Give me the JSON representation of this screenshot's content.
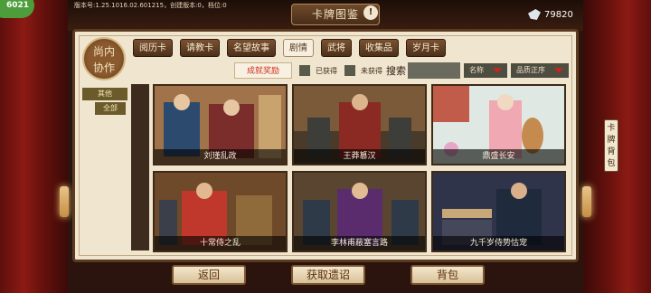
{
  "status": {
    "version_text": "版本号:1.25.1016.02.601215，创建版本:0，档位:0",
    "badge": "6021"
  },
  "header": {
    "title": "卡牌图鉴",
    "info_glyph": "!",
    "currency_value": "79820"
  },
  "emblem": {
    "text_line1": "尚内",
    "text_line2": "协作"
  },
  "tabs": [
    {
      "label": "阅历卡",
      "active": false
    },
    {
      "label": "请教卡",
      "active": false
    },
    {
      "label": "名望故事",
      "active": false
    },
    {
      "label": "剧情",
      "active": true
    },
    {
      "label": "武将",
      "active": false
    },
    {
      "label": "收集品",
      "active": false
    },
    {
      "label": "岁月卡",
      "active": false
    }
  ],
  "filters": {
    "achievement_btn": "成就奖励",
    "owned": "已获得",
    "not_owned": "未获得",
    "search_label": "搜索",
    "sort_name": "名称",
    "sort_order": "品质正序"
  },
  "side_menu": {
    "other": "其他",
    "all": "全部"
  },
  "cards": [
    {
      "title": "刘瑾乱政"
    },
    {
      "title": "王莽篡汉"
    },
    {
      "title": "鼎盛长安"
    },
    {
      "title": "十常侍之乱"
    },
    {
      "title": "李林甫蔽塞言路"
    },
    {
      "title": "九千岁侍势怙宠"
    }
  ],
  "bag_side": "卡牌背包",
  "bottom_buttons": {
    "back": "返回",
    "get_relic": "获取遗诏",
    "bag": "背包"
  }
}
